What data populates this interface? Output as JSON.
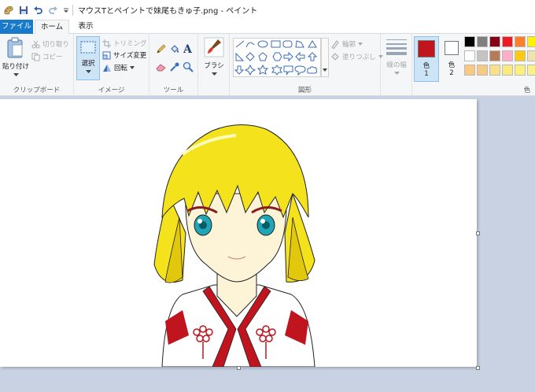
{
  "titlebar": {
    "title": "マウスTとペイントで妹尾もきゅ子.png - ペイント"
  },
  "tabs": {
    "file": "ファイル",
    "home": "ホーム",
    "view": "表示"
  },
  "clipboard": {
    "paste": "貼り付け",
    "cut": "切り取り",
    "copy": "コピー",
    "label": "クリップボード"
  },
  "image": {
    "select": "選択",
    "crop": "トリミング",
    "resize": "サイズ変更",
    "rotate": "回転",
    "label": "イメージ"
  },
  "tools": {
    "label": "ツール"
  },
  "brush": {
    "label": "ブラシ"
  },
  "shapes": {
    "outline": "輪郭",
    "fill": "塗りつぶし",
    "label": "図形"
  },
  "size": {
    "label": "線の幅"
  },
  "colors": {
    "color1_label": "色",
    "color1_num": "1",
    "color2_label": "色",
    "color2_num": "2",
    "label": "色",
    "color1": "#c0141e",
    "color2": "#ffffff",
    "palette_row1": [
      "#000000",
      "#7f7f7f",
      "#880015",
      "#ed1c24",
      "#ff7f27",
      "#fff200"
    ],
    "palette_row2": [
      "#ffffff",
      "#c3c3c3",
      "#b97a57",
      "#ffaec9",
      "#ffc90e",
      "#efe4b0"
    ],
    "palette_row3": [
      "#f8c980",
      "#f8c980",
      "#fbe08a",
      "#fcea7a",
      "#fdf07a",
      "#fdf28a"
    ]
  }
}
